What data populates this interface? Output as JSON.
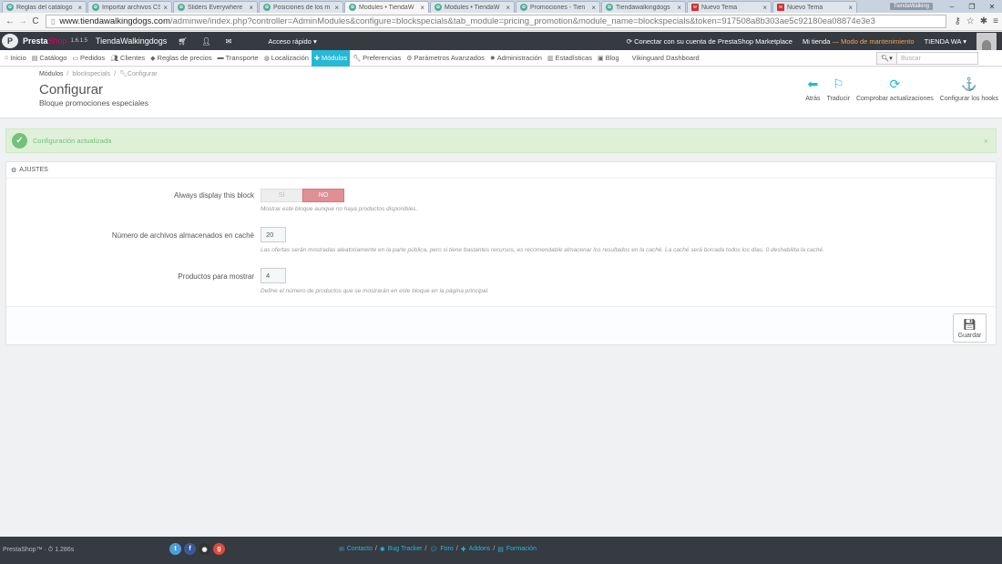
{
  "browser": {
    "tabs": [
      {
        "label": "Reglas del catálogo",
        "icon": "prestashop-favicon"
      },
      {
        "label": "Importar archivos CS",
        "icon": "prestashop-favicon"
      },
      {
        "label": "Sliders Everywhere",
        "icon": "prestashop-favicon"
      },
      {
        "label": "Posiciones de los m",
        "icon": "prestashop-favicon"
      },
      {
        "label": "Modules • TiendaW",
        "icon": "prestashop-favicon"
      },
      {
        "label": "Modules • TiendaW",
        "icon": "prestashop-favicon"
      },
      {
        "label": "Promociones - Tien",
        "icon": "prestashop-favicon"
      },
      {
        "label": "Tiendawalkingdogs",
        "icon": "prestashop-favicon"
      },
      {
        "label": "Nuevo Tema",
        "icon": "theme-favicon"
      },
      {
        "label": "Nuevo Tema",
        "icon": "theme-favicon"
      }
    ],
    "active_tab_index": 4,
    "window_user": "TiendaWalking",
    "url_host": "www.tiendawalkingdogs.com",
    "url_path": "/adminwe/index.php?controller=AdminModules&configure=blockspecials&tab_module=pricing_promotion&module_name=blockspecials&token=917508a8b303ae5c92180ea08874e3e3"
  },
  "header": {
    "logo_presta": "Presta",
    "logo_shop": "Shop",
    "version": "1.6.1.5",
    "shop_name": "TiendaWalkingdogs",
    "quick_access": "Acceso rápido",
    "marketplace": "Conectar con su cuenta de PrestaShop Marketplace",
    "my_shop": "Mi tienda",
    "maintenance": "— Modo de mantenimiento",
    "store_user": "TIENDA WA"
  },
  "menu": {
    "items": [
      {
        "label": "Inicio",
        "icon": "dashboard-icon"
      },
      {
        "label": "Catálogo",
        "icon": "book-icon"
      },
      {
        "label": "Pedidos",
        "icon": "credit-card-icon"
      },
      {
        "label": "Clientes",
        "icon": "users-icon"
      },
      {
        "label": "Reglas de precios",
        "icon": "tag-icon"
      },
      {
        "label": "Transporte",
        "icon": "truck-icon"
      },
      {
        "label": "Localización",
        "icon": "globe-icon"
      },
      {
        "label": "Módulos",
        "icon": "puzzle-icon"
      },
      {
        "label": "Preferencias",
        "icon": "wrench-icon"
      },
      {
        "label": "Parámetros Avanzados",
        "icon": "cogs-icon"
      },
      {
        "label": "Administración",
        "icon": "cog-icon"
      },
      {
        "label": "Estadísticas",
        "icon": "bar-chart-icon"
      },
      {
        "label": "Blog",
        "icon": "blog-icon"
      },
      {
        "label": "Vikinguard Dashboard",
        "icon": ""
      }
    ],
    "active_index": 7,
    "search_placeholder": "Buscar"
  },
  "page": {
    "breadcrumb": [
      "Módulos",
      "blockspecials",
      "Configurar"
    ],
    "title": "Configurar",
    "subtitle": "Bloque promociones especiales",
    "toolbar": [
      {
        "label": "Atrás",
        "icon": "arrow-left-circle-icon"
      },
      {
        "label": "Traducir",
        "icon": "flag-icon"
      },
      {
        "label": "Comprobar actualizaciones",
        "icon": "refresh-icon"
      },
      {
        "label": "Configurar los hooks",
        "icon": "anchor-icon"
      }
    ]
  },
  "alert": {
    "message": "Configuración actualizada",
    "close": "×"
  },
  "panel": {
    "heading": "AJUSTES",
    "fields": {
      "always_display": {
        "label": "Always display this block",
        "yes": "SÍ",
        "no": "NO",
        "selected": "NO",
        "help": "Mostrar este bloque aunque no haya productos disponibles."
      },
      "cache": {
        "label": "Número de archivos almacenados en caché",
        "value": "20",
        "help": "Las ofertas serán mostradas aleatoriamente en la parte pública, pero si tiene bastantes recursos, es recomendable almacenar los resultados en la caché. La caché será borrada todos los días. 0 deshabilita la caché."
      },
      "products": {
        "label": "Productos para mostrar",
        "value": "4",
        "help": "Define el número de productos que se mostrarán en este bloque en la página principal."
      }
    },
    "save_label": "Guardar"
  },
  "footer": {
    "version": "PrestaShop™ · ⏱ 1.286s",
    "links": [
      "Contacto",
      "Bug Tracker",
      "Foro",
      "Addons",
      "Formación"
    ],
    "social_colors": {
      "twitter": "#4a9fd8",
      "facebook": "#3b5998",
      "github": "#333333",
      "google": "#dd4b39"
    }
  },
  "colors": {
    "accent": "#25b9d7",
    "success": "#72c279",
    "danger_switch": "#e08f95",
    "header_bg": "#363a41",
    "brand_pink": "#df0067"
  }
}
